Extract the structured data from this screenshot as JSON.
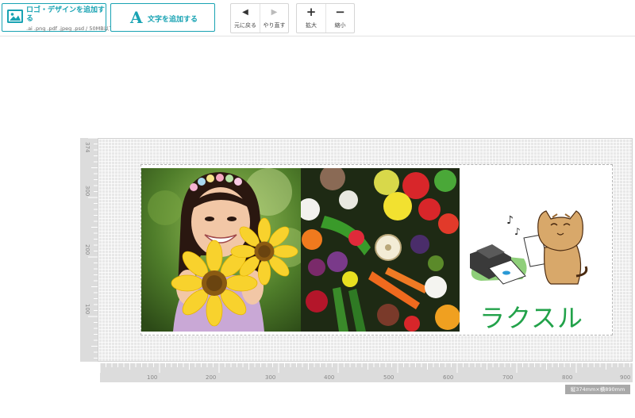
{
  "toolbar": {
    "add_logo": {
      "label": "ロゴ・デザインを追加する",
      "formats": ".ai .png .pdf .jpeg .psd / 50MB以下",
      "icon": "image-icon"
    },
    "add_text": {
      "glyph": "A",
      "label": "文字を追加する",
      "icon": "text-a-icon"
    },
    "undo": {
      "glyph": "◀",
      "label": "元に戻る"
    },
    "redo": {
      "glyph": "▶",
      "label": "やり直す"
    },
    "zoom_in": {
      "glyph": "+",
      "label": "拡大"
    },
    "zoom_out": {
      "glyph": "−",
      "label": "縮小"
    }
  },
  "rulers": {
    "horizontal": [
      "100",
      "200",
      "300",
      "400",
      "500",
      "600",
      "700",
      "800",
      "900"
    ],
    "vertical": [
      "374",
      "300",
      "200",
      "100"
    ]
  },
  "design": {
    "photo_1": "girl-with-sunflowers-photo",
    "photo_2": "vegetables-photo",
    "illustration": "cat-with-printer-illustration",
    "brand_text": "ラクスル",
    "brand_color": "#22a24a"
  },
  "canvas": {
    "size_label": "縦374mm×横890mm"
  },
  "colors": {
    "accent": "#19a3b3",
    "grid": "#e8e8e8"
  }
}
